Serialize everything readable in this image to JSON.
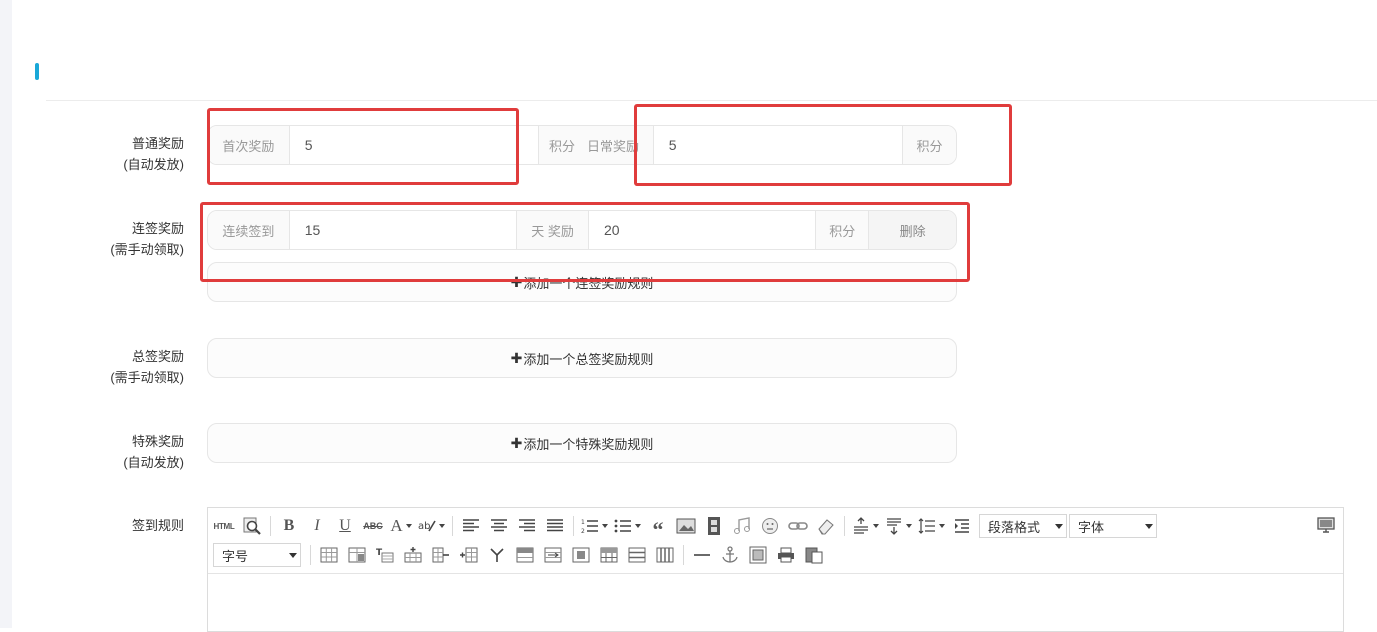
{
  "normal_reward": {
    "label_line1": "普通奖励",
    "label_line2": "(自动发放)",
    "first_prefix": "首次奖励",
    "first_value": "5",
    "first_suffix": "积分",
    "daily_prefix": "日常奖励",
    "daily_value": "5",
    "daily_suffix": "积分"
  },
  "streak_reward": {
    "label_line1": "连签奖励",
    "label_line2": "(需手动领取)",
    "rule": {
      "prefix": "连续签到",
      "days": "15",
      "mid": "天 奖励",
      "points": "20",
      "suffix": "积分",
      "delete_label": "删除"
    },
    "add_label": "添加一个连签奖励规则"
  },
  "total_reward": {
    "label_line1": "总签奖励",
    "label_line2": "(需手动领取)",
    "add_label": "添加一个总签奖励规则"
  },
  "special_reward": {
    "label_line1": "特殊奖励",
    "label_line2": "(自动发放)",
    "add_label": "添加一个特殊奖励规则"
  },
  "sign_rules": {
    "label": "签到规则",
    "paragraph_select": "段落格式",
    "font_select": "字体",
    "size_select": "字号",
    "html_label": "HTML"
  },
  "colors": {
    "accent": "#1aa8d8",
    "highlight": "#e03c3c"
  }
}
